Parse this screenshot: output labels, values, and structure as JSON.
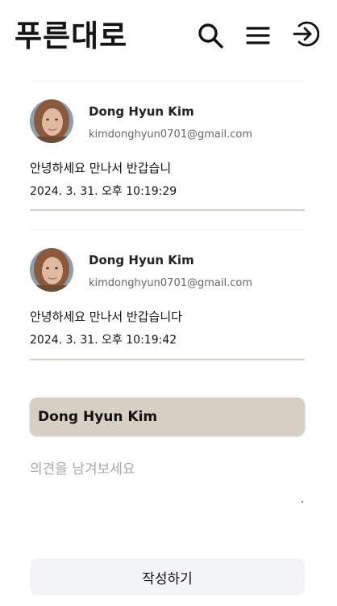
{
  "header": {
    "logo": "푸른대로",
    "icons": [
      "search-icon",
      "menu-icon",
      "login-icon"
    ]
  },
  "comments": [
    {
      "name": "Dong Hyun Kim",
      "email": "kimdonghyun0701@gmail.com",
      "text": "안녕하세요 만나서 반갑습니",
      "date": "2024. 3. 31. 오후 10:19:29"
    },
    {
      "name": "Dong Hyun Kim",
      "email": "kimdonghyun0701@gmail.com",
      "text": "안녕하세요 만나서 반갑습니다",
      "date": "2024. 3. 31. 오후 10:19:42"
    }
  ],
  "form": {
    "author_name": "Dong Hyun Kim",
    "placeholder": "의견을 남겨보세요",
    "submit_label": "작성하기"
  },
  "colors": {
    "accent": "#d8cfc4",
    "button_bg": "#f3f4f6",
    "text": "#111111"
  }
}
